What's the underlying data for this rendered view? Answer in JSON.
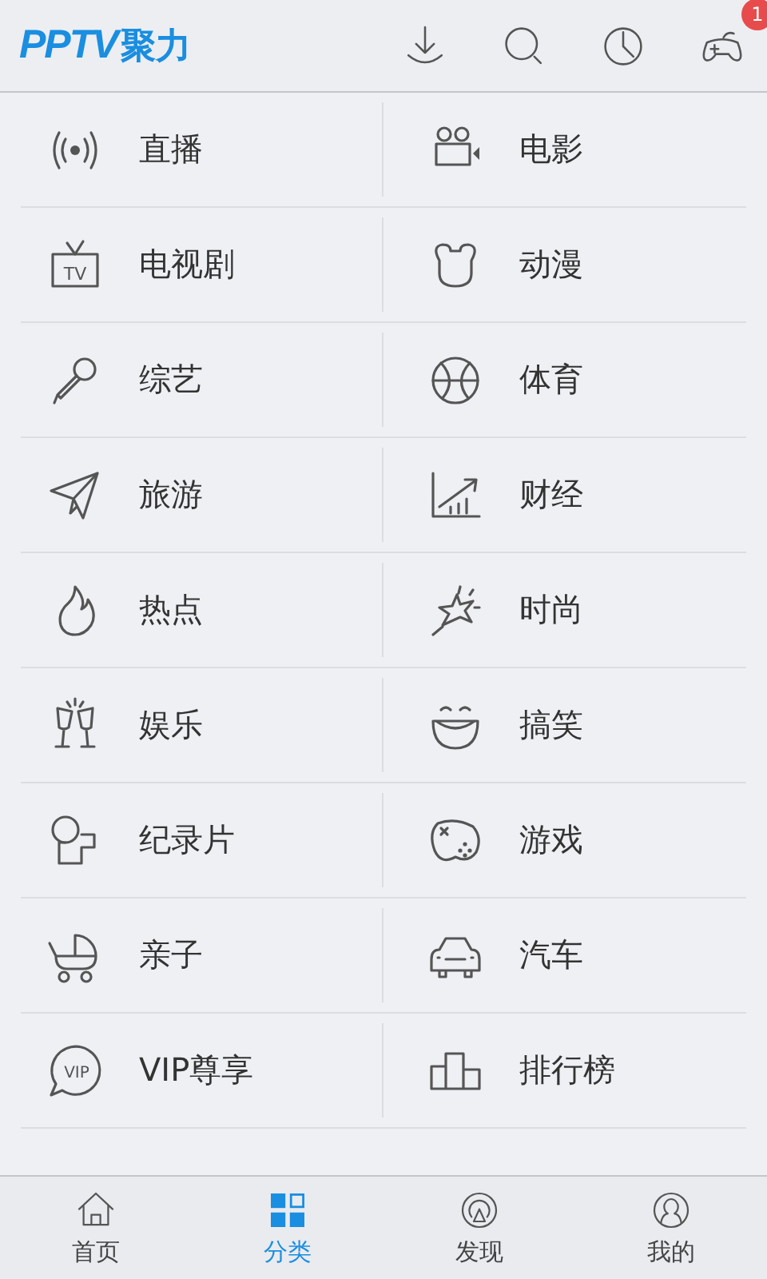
{
  "header": {
    "logo": {
      "latin": "PPTV",
      "chinese": "聚力"
    },
    "actions": [
      {
        "kind": "download"
      },
      {
        "kind": "search"
      },
      {
        "kind": "history"
      },
      {
        "kind": "games",
        "badge": "1"
      }
    ]
  },
  "categories": [
    {
      "label": "直播",
      "kind": "live"
    },
    {
      "label": "电影",
      "kind": "movie"
    },
    {
      "label": "电视剧",
      "kind": "tv",
      "icon_text": "TV"
    },
    {
      "label": "动漫",
      "kind": "bear"
    },
    {
      "label": "综艺",
      "kind": "mic"
    },
    {
      "label": "体育",
      "kind": "ball"
    },
    {
      "label": "旅游",
      "kind": "plane"
    },
    {
      "label": "财经",
      "kind": "chart"
    },
    {
      "label": "热点",
      "kind": "flame"
    },
    {
      "label": "时尚",
      "kind": "burst"
    },
    {
      "label": "娱乐",
      "kind": "glasses"
    },
    {
      "label": "搞笑",
      "kind": "laugh"
    },
    {
      "label": "纪录片",
      "kind": "doc"
    },
    {
      "label": "游戏",
      "kind": "game"
    },
    {
      "label": "亲子",
      "kind": "stroller"
    },
    {
      "label": "汽车",
      "kind": "car"
    },
    {
      "label": "VIP尊享",
      "kind": "vip",
      "icon_text": "VIP"
    },
    {
      "label": "排行榜",
      "kind": "podium"
    }
  ],
  "tab_bar": [
    {
      "label": "首页",
      "kind": "home",
      "selected": false
    },
    {
      "label": "分类",
      "kind": "grid",
      "selected": true
    },
    {
      "label": "发现",
      "kind": "discover",
      "selected": false
    },
    {
      "label": "我的",
      "kind": "me",
      "selected": false
    }
  ]
}
